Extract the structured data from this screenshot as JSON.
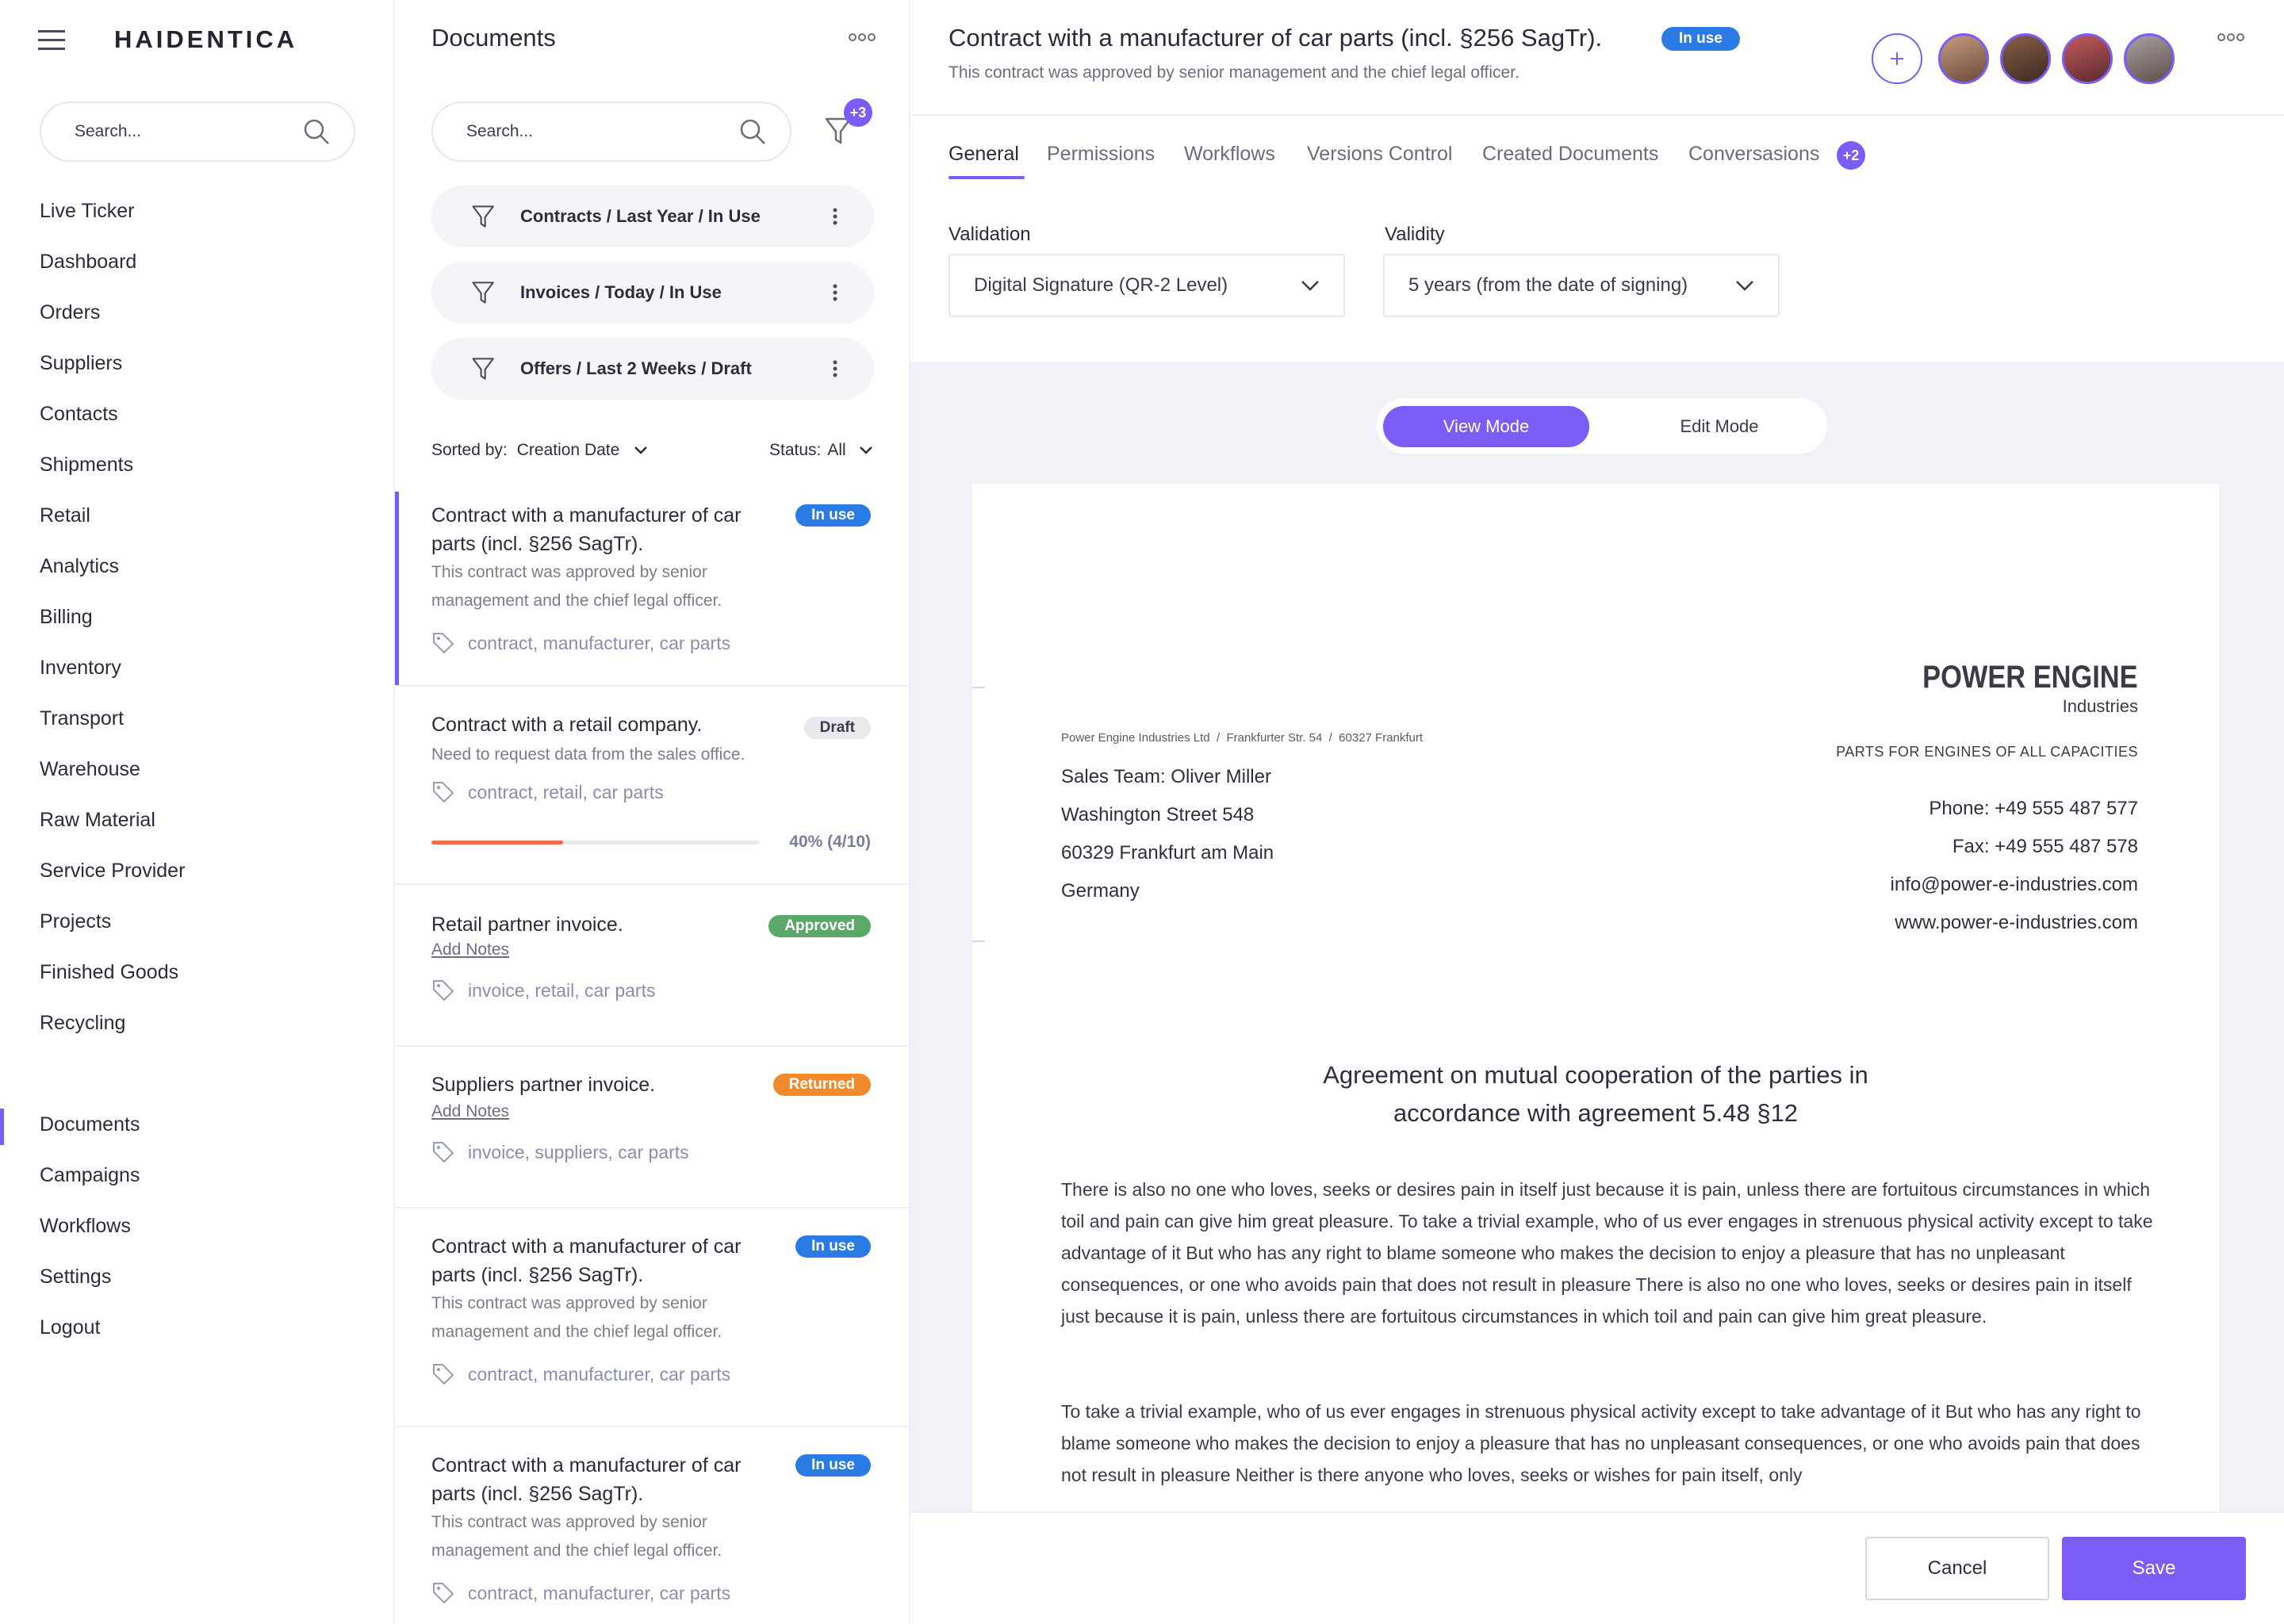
{
  "sidebar": {
    "brand": "HAIDENTICA",
    "search_placeholder": "Search...",
    "items": [
      "Live Ticker",
      "Dashboard",
      "Orders",
      "Suppliers",
      "Contacts",
      "Shipments",
      "Retail",
      "Analytics",
      "Billing",
      "Inventory",
      "Transport",
      "Warehouse",
      "Raw Material",
      "Service Provider",
      "Projects",
      "Finished Goods",
      "Recycling"
    ],
    "bottom_items": [
      "Documents",
      "Campaigns",
      "Workflows",
      "Settings",
      "Logout"
    ],
    "active_item": "Documents",
    "accent_color": "#7b5cf5"
  },
  "documents": {
    "title": "Documents",
    "search_placeholder": "Search...",
    "filter_count_badge": "+3",
    "saved_filters": [
      "Contracts / Last Year / In Use",
      "Invoices / Today / In Use",
      "Offers / Last 2 Weeks / Draft"
    ],
    "sorted_by_label": "Sorted by:",
    "sorted_by_value": "Creation Date",
    "status_label": "Status:",
    "status_value": "All",
    "add_notes": "Add Notes",
    "cards": [
      {
        "title": "Contract with a manufacturer of car parts (incl. §256 SagTr).",
        "desc": "This contract was approved by senior management and the chief legal officer.",
        "tags": "contract, manufacturer, car parts",
        "badge": "In use",
        "badge_color": "#2a7be4"
      },
      {
        "title": "Contract with a retail company.",
        "desc": "Need to request data from the sales office.",
        "tags": "contract, retail, car parts",
        "badge": "Draft",
        "badge_color": "#e9eaee",
        "progress_fraction": 0.4,
        "progress_label": "40% (4/10)",
        "progress_color": "#f0694a"
      },
      {
        "title": "Retail partner invoice.",
        "tags": "invoice, retail, car parts",
        "badge": "Approved",
        "badge_color": "#5aa86a"
      },
      {
        "title": "Suppliers partner invoice.",
        "tags": "invoice, suppliers, car parts",
        "badge": "Returned",
        "badge_color": "#f08a2a"
      },
      {
        "title": "Contract with a manufacturer of car parts (incl. §256 SagTr).",
        "desc": "This contract was approved by senior management and the chief legal officer.",
        "tags": "contract, manufacturer, car parts",
        "badge": "In use",
        "badge_color": "#2a7be4"
      },
      {
        "title": "Contract with a manufacturer of car parts (incl. §256 SagTr).",
        "desc": "This contract was approved by senior management and the chief legal officer.",
        "tags": "contract, manufacturer, car parts",
        "badge": "In use",
        "badge_color": "#2a7be4"
      }
    ]
  },
  "main": {
    "title": "Contract with a manufacturer of car parts (incl. §256 SagTr).",
    "status_badge": "In use",
    "subtitle": "This contract was approved by senior management and the chief legal officer.",
    "tabs": [
      "General",
      "Permissions",
      "Workflows",
      "Versions Control",
      "Created Documents",
      "Conversasions"
    ],
    "active_tab": "General",
    "conversations_badge": "+2",
    "validation_label": "Validation",
    "validation_value": "Digital Signature (QR-2 Level)",
    "validity_label": "Validity",
    "validity_value": "5 years (from the date of signing)",
    "view_mode": "View Mode",
    "edit_mode": "Edit Mode",
    "cancel": "Cancel",
    "save": "Save"
  },
  "letter": {
    "company_name": "POWER ENGINE",
    "company_sub": "Industries",
    "sender_line": "Power Engine Industries Ltd  /  Frankfurter Str. 54  /  60327 Frankfurt",
    "tagline": "PARTS FOR ENGINES OF ALL CAPACITIES",
    "recipient": [
      "Sales Team: Oliver Miller",
      "Washington Street 548",
      "60329 Frankfurt am Main",
      "Germany"
    ],
    "contact": [
      "Phone: +49 555 487 577",
      "Fax: +49 555 487 578",
      "info@power-e-industries.com",
      "www.power-e-industries.com"
    ],
    "heading_line1": "Agreement on mutual cooperation of the parties in",
    "heading_line2": "accordance with agreement 5.48 §12",
    "paragraph1": "There is also no one who loves, seeks or desires pain in itself just because it is pain, unless there are fortuitous circumstances in which toil and pain can give him great pleasure. To take a trivial example, who of us ever engages in strenuous physical activity except to take advantage of it But who has any right to blame someone who makes the decision to enjoy a pleasure that has no unpleasant consequences, or one who avoids pain that does not result in pleasure There is also no one who loves, seeks or desires pain in itself just because it is pain, unless there are fortuitous circumstances in which toil and pain can give him great pleasure.",
    "paragraph2": "To take a trivial example, who of us ever engages in strenuous physical activity except to take advantage of it But who has any right to blame someone who makes the decision to enjoy a pleasure that has no unpleasant consequences, or one who avoids pain that does not result in pleasure Neither is there anyone who loves, seeks or wishes for pain itself, only"
  }
}
